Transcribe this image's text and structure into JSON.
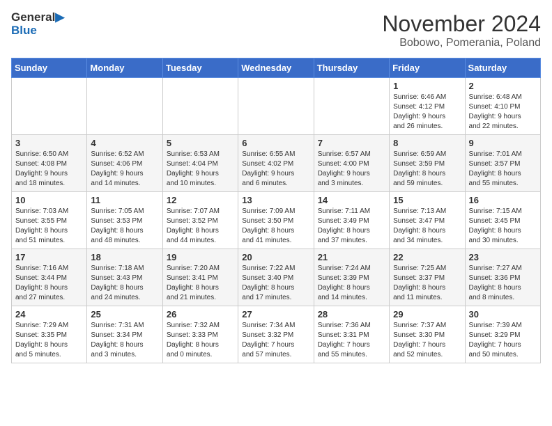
{
  "logo": {
    "line1": "General",
    "line2": "Blue"
  },
  "title": "November 2024",
  "location": "Bobowo, Pomerania, Poland",
  "headers": [
    "Sunday",
    "Monday",
    "Tuesday",
    "Wednesday",
    "Thursday",
    "Friday",
    "Saturday"
  ],
  "weeks": [
    [
      {
        "day": "",
        "info": ""
      },
      {
        "day": "",
        "info": ""
      },
      {
        "day": "",
        "info": ""
      },
      {
        "day": "",
        "info": ""
      },
      {
        "day": "",
        "info": ""
      },
      {
        "day": "1",
        "info": "Sunrise: 6:46 AM\nSunset: 4:12 PM\nDaylight: 9 hours\nand 26 minutes."
      },
      {
        "day": "2",
        "info": "Sunrise: 6:48 AM\nSunset: 4:10 PM\nDaylight: 9 hours\nand 22 minutes."
      }
    ],
    [
      {
        "day": "3",
        "info": "Sunrise: 6:50 AM\nSunset: 4:08 PM\nDaylight: 9 hours\nand 18 minutes."
      },
      {
        "day": "4",
        "info": "Sunrise: 6:52 AM\nSunset: 4:06 PM\nDaylight: 9 hours\nand 14 minutes."
      },
      {
        "day": "5",
        "info": "Sunrise: 6:53 AM\nSunset: 4:04 PM\nDaylight: 9 hours\nand 10 minutes."
      },
      {
        "day": "6",
        "info": "Sunrise: 6:55 AM\nSunset: 4:02 PM\nDaylight: 9 hours\nand 6 minutes."
      },
      {
        "day": "7",
        "info": "Sunrise: 6:57 AM\nSunset: 4:00 PM\nDaylight: 9 hours\nand 3 minutes."
      },
      {
        "day": "8",
        "info": "Sunrise: 6:59 AM\nSunset: 3:59 PM\nDaylight: 8 hours\nand 59 minutes."
      },
      {
        "day": "9",
        "info": "Sunrise: 7:01 AM\nSunset: 3:57 PM\nDaylight: 8 hours\nand 55 minutes."
      }
    ],
    [
      {
        "day": "10",
        "info": "Sunrise: 7:03 AM\nSunset: 3:55 PM\nDaylight: 8 hours\nand 51 minutes."
      },
      {
        "day": "11",
        "info": "Sunrise: 7:05 AM\nSunset: 3:53 PM\nDaylight: 8 hours\nand 48 minutes."
      },
      {
        "day": "12",
        "info": "Sunrise: 7:07 AM\nSunset: 3:52 PM\nDaylight: 8 hours\nand 44 minutes."
      },
      {
        "day": "13",
        "info": "Sunrise: 7:09 AM\nSunset: 3:50 PM\nDaylight: 8 hours\nand 41 minutes."
      },
      {
        "day": "14",
        "info": "Sunrise: 7:11 AM\nSunset: 3:49 PM\nDaylight: 8 hours\nand 37 minutes."
      },
      {
        "day": "15",
        "info": "Sunrise: 7:13 AM\nSunset: 3:47 PM\nDaylight: 8 hours\nand 34 minutes."
      },
      {
        "day": "16",
        "info": "Sunrise: 7:15 AM\nSunset: 3:45 PM\nDaylight: 8 hours\nand 30 minutes."
      }
    ],
    [
      {
        "day": "17",
        "info": "Sunrise: 7:16 AM\nSunset: 3:44 PM\nDaylight: 8 hours\nand 27 minutes."
      },
      {
        "day": "18",
        "info": "Sunrise: 7:18 AM\nSunset: 3:43 PM\nDaylight: 8 hours\nand 24 minutes."
      },
      {
        "day": "19",
        "info": "Sunrise: 7:20 AM\nSunset: 3:41 PM\nDaylight: 8 hours\nand 21 minutes."
      },
      {
        "day": "20",
        "info": "Sunrise: 7:22 AM\nSunset: 3:40 PM\nDaylight: 8 hours\nand 17 minutes."
      },
      {
        "day": "21",
        "info": "Sunrise: 7:24 AM\nSunset: 3:39 PM\nDaylight: 8 hours\nand 14 minutes."
      },
      {
        "day": "22",
        "info": "Sunrise: 7:25 AM\nSunset: 3:37 PM\nDaylight: 8 hours\nand 11 minutes."
      },
      {
        "day": "23",
        "info": "Sunrise: 7:27 AM\nSunset: 3:36 PM\nDaylight: 8 hours\nand 8 minutes."
      }
    ],
    [
      {
        "day": "24",
        "info": "Sunrise: 7:29 AM\nSunset: 3:35 PM\nDaylight: 8 hours\nand 5 minutes."
      },
      {
        "day": "25",
        "info": "Sunrise: 7:31 AM\nSunset: 3:34 PM\nDaylight: 8 hours\nand 3 minutes."
      },
      {
        "day": "26",
        "info": "Sunrise: 7:32 AM\nSunset: 3:33 PM\nDaylight: 8 hours\nand 0 minutes."
      },
      {
        "day": "27",
        "info": "Sunrise: 7:34 AM\nSunset: 3:32 PM\nDaylight: 7 hours\nand 57 minutes."
      },
      {
        "day": "28",
        "info": "Sunrise: 7:36 AM\nSunset: 3:31 PM\nDaylight: 7 hours\nand 55 minutes."
      },
      {
        "day": "29",
        "info": "Sunrise: 7:37 AM\nSunset: 3:30 PM\nDaylight: 7 hours\nand 52 minutes."
      },
      {
        "day": "30",
        "info": "Sunrise: 7:39 AM\nSunset: 3:29 PM\nDaylight: 7 hours\nand 50 minutes."
      }
    ]
  ]
}
